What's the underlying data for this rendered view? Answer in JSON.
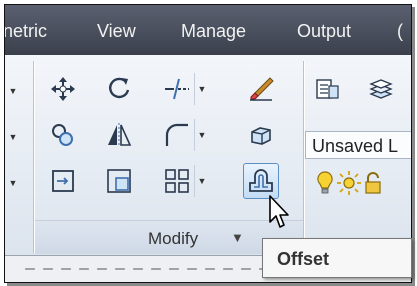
{
  "tabs": [
    {
      "label": "netric"
    },
    {
      "label": "View"
    },
    {
      "label": "Manage"
    },
    {
      "label": "Output"
    },
    {
      "label": "("
    }
  ],
  "modify_panel": {
    "title": "Modify",
    "tools": [
      {
        "icon": "move-icon"
      },
      {
        "icon": "rotate-icon"
      },
      {
        "icon": "trim-icon"
      },
      {
        "icon": "erase-icon"
      },
      {
        "icon": "copy-icon"
      },
      {
        "icon": "mirror-icon"
      },
      {
        "icon": "fillet-icon"
      },
      {
        "icon": "explode-icon"
      },
      {
        "icon": "stretch-icon"
      },
      {
        "icon": "scale-icon"
      },
      {
        "icon": "array-icon"
      },
      {
        "icon": "offset-icon"
      }
    ]
  },
  "layers_panel": {
    "current_layer": "Unsaved L"
  },
  "tooltip": {
    "text": "Offset"
  }
}
